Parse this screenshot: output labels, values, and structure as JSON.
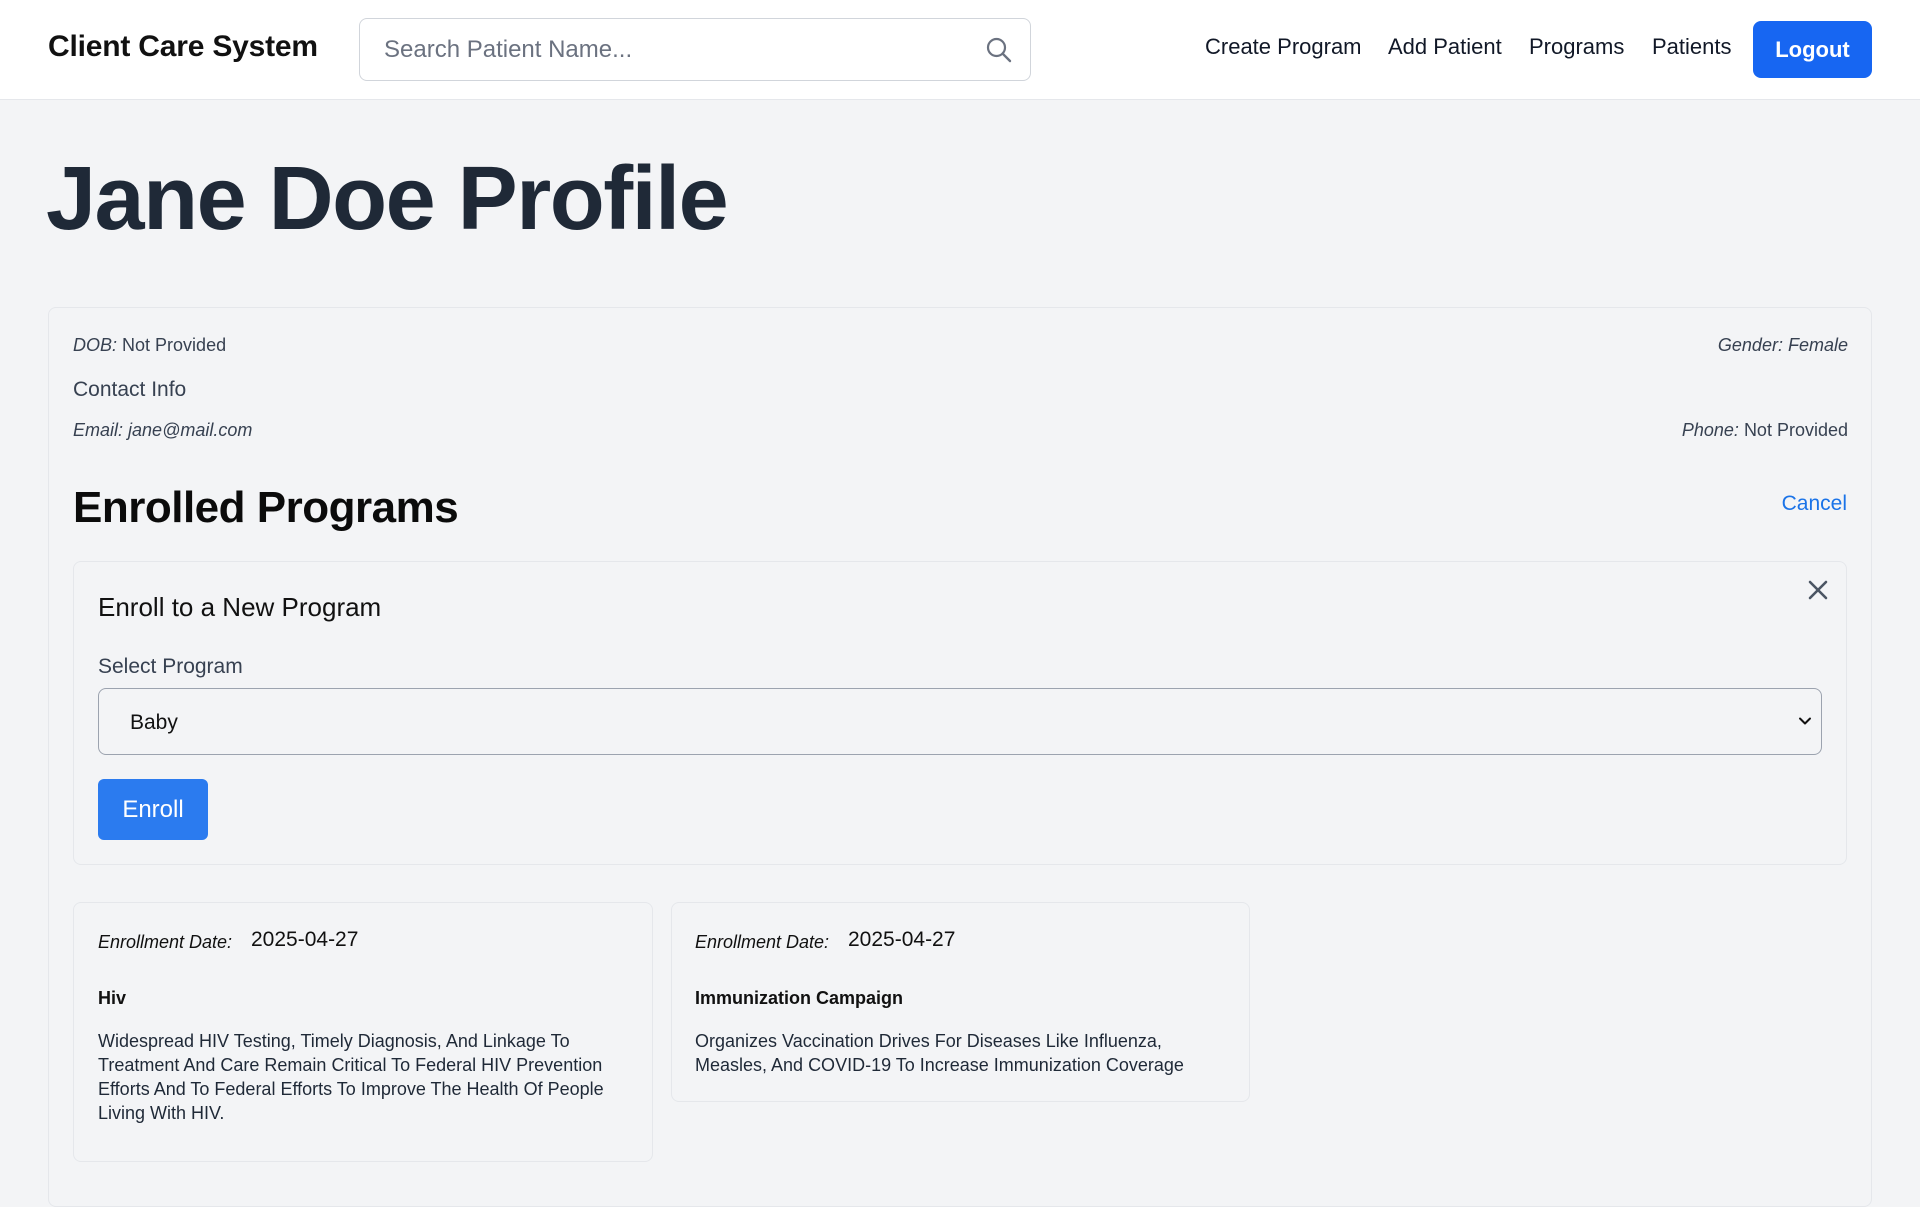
{
  "app": {
    "title": "Client Care System"
  },
  "search": {
    "placeholder": "Search Patient Name..."
  },
  "nav": {
    "create_program": "Create Program",
    "add_patient": "Add Patient",
    "programs": "Programs",
    "patients": "Patients",
    "logout": "Logout"
  },
  "page": {
    "title": "Jane Doe Profile"
  },
  "profile": {
    "dob_label": "DOB:",
    "dob_value": "Not Provided",
    "gender_label": "Gender:",
    "gender_value": "Female",
    "contact_heading": "Contact Info",
    "email_label": "Email:",
    "email_value": "jane@mail.com",
    "phone_label": "Phone:",
    "phone_value": "Not Provided"
  },
  "enrolled": {
    "heading": "Enrolled Programs",
    "cancel_label": "Cancel"
  },
  "enroll_form": {
    "title": "Enroll to a New Program",
    "select_label": "Select Program",
    "selected_program": "Baby",
    "submit_label": "Enroll"
  },
  "programs": [
    {
      "date_label": "Enrollment Date:",
      "date_value": "2025-04-27",
      "name": "Hiv",
      "description": "Widespread HIV Testing, Timely Diagnosis, And Linkage To Treatment And Care Remain Critical To Federal HIV Prevention Efforts And To Federal Efforts To Improve The Health Of People Living With HIV."
    },
    {
      "date_label": "Enrollment Date:",
      "date_value": "2025-04-27",
      "name": "Immunization Campaign",
      "description": "Organizes Vaccination Drives For Diseases Like Influenza, Measles, And COVID-19 To Increase Immunization Coverage"
    }
  ],
  "colors": {
    "primary_button": "#1766f2",
    "enroll_button": "#2b7bef",
    "link": "#1a73e8",
    "background": "#f3f4f6"
  },
  "icons": {
    "search": "search-icon",
    "close": "close-icon",
    "dropdown": "chevron-down-icon"
  }
}
